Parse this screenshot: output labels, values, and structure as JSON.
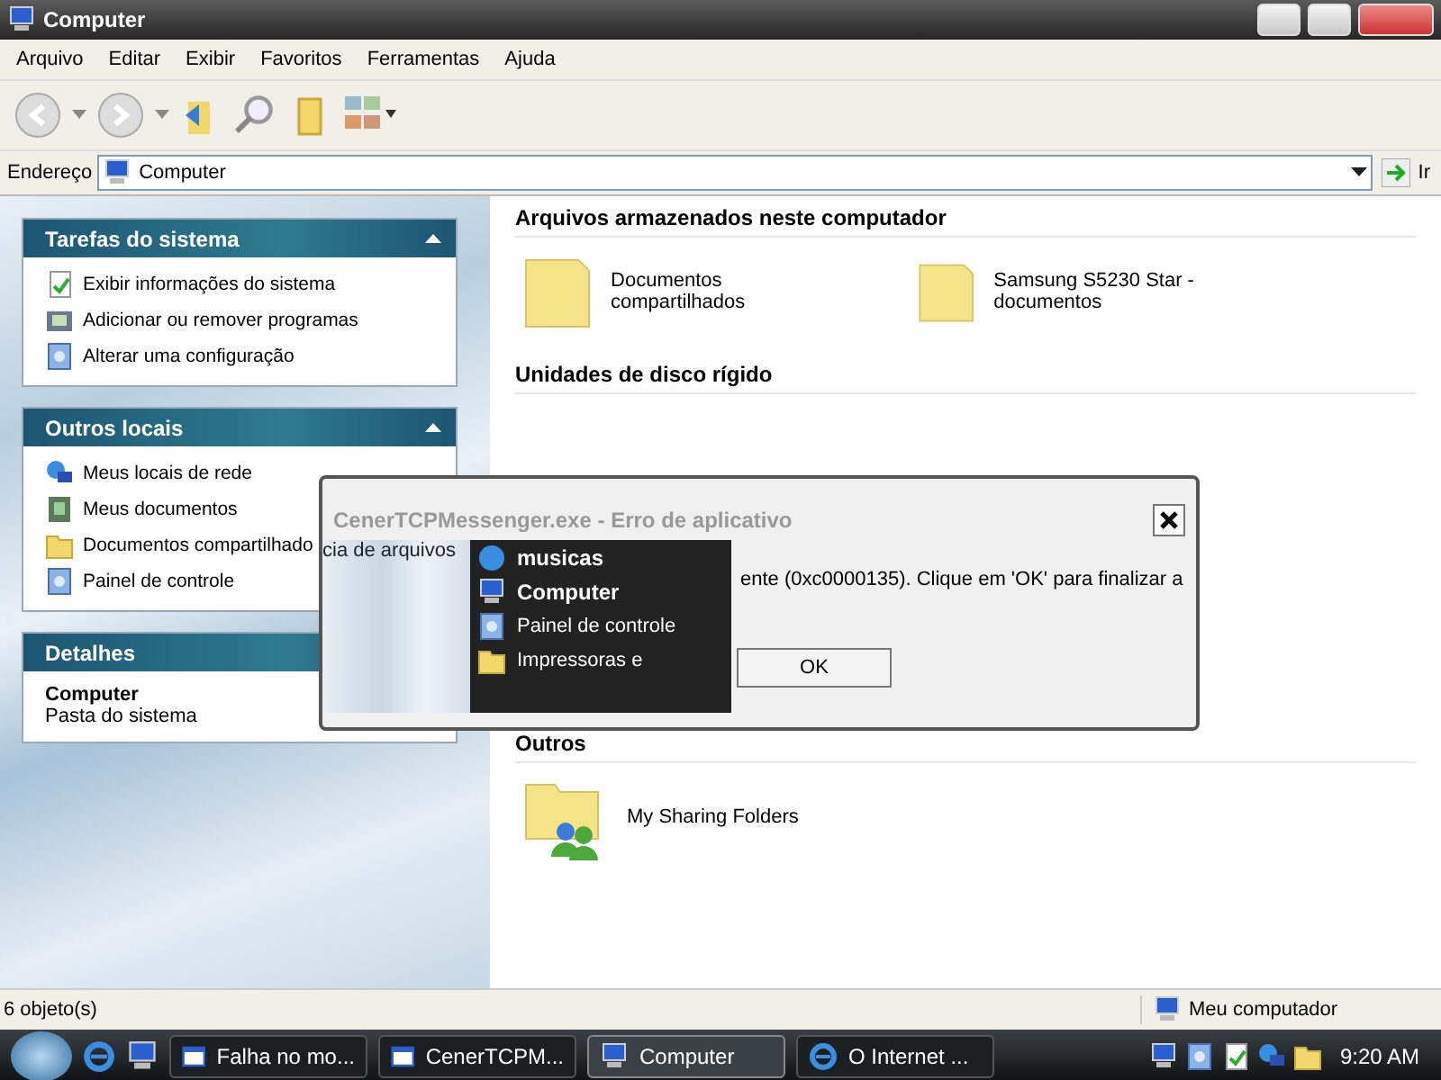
{
  "window": {
    "title": "Computer"
  },
  "menu": [
    "Arquivo",
    "Editar",
    "Exibir",
    "Favoritos",
    "Ferramentas",
    "Ajuda"
  ],
  "address": {
    "label": "Endereço",
    "value": "Computer",
    "go": "Ir"
  },
  "sidebar": {
    "panels": [
      {
        "title": "Tarefas do sistema",
        "expanded": true,
        "items": [
          {
            "label": "Exibir informações do sistema"
          },
          {
            "label": "Adicionar ou remover programas"
          },
          {
            "label": "Alterar uma configuração"
          }
        ]
      },
      {
        "title": "Outros locais",
        "expanded": true,
        "items": [
          {
            "label": "Meus locais de rede"
          },
          {
            "label": "Meus documentos"
          },
          {
            "label": "Documentos compartilhado"
          },
          {
            "label": "Painel de controle"
          }
        ]
      }
    ],
    "details": {
      "title": "Detalhes",
      "name": "Computer",
      "description": "Pasta do sistema"
    }
  },
  "content": {
    "groups": [
      {
        "title": "Arquivos armazenados neste computador",
        "items": [
          {
            "label": "Documentos compartilhados",
            "kind": "folder"
          },
          {
            "label": "Samsung S5230 Star - documentos",
            "kind": "folder"
          }
        ]
      },
      {
        "title": "Unidades de disco rígido"
      },
      {
        "title": "Outros",
        "items": [
          {
            "label": "My Sharing Folders",
            "kind": "shared"
          }
        ]
      }
    ]
  },
  "dialog": {
    "title": "CenerTCPMessenger.exe - Erro de aplicativo",
    "ghost_text": "cia de arquivos",
    "message": "ente (0xc0000135). Clique em 'OK' para finalizar a",
    "ok": "OK",
    "menu_fragment": [
      {
        "label": "musicas",
        "bold": true
      },
      {
        "label": "Computer",
        "bold": true
      },
      {
        "label": "Painel de controle",
        "bold": false
      },
      {
        "label": "Impressoras e",
        "bold": false
      }
    ]
  },
  "status_bar": {
    "left": "6 objeto(s)",
    "right": "Meu computador"
  },
  "taskbar": {
    "buttons": [
      {
        "label": "Falha no mo...",
        "kind": "window",
        "selected": false
      },
      {
        "label": "CenerTCPM...",
        "kind": "window",
        "selected": false
      },
      {
        "label": "Computer",
        "kind": "computer",
        "selected": true
      },
      {
        "label": "O Internet ...",
        "kind": "browser",
        "selected": false
      }
    ],
    "clock": "9:20 AM"
  }
}
